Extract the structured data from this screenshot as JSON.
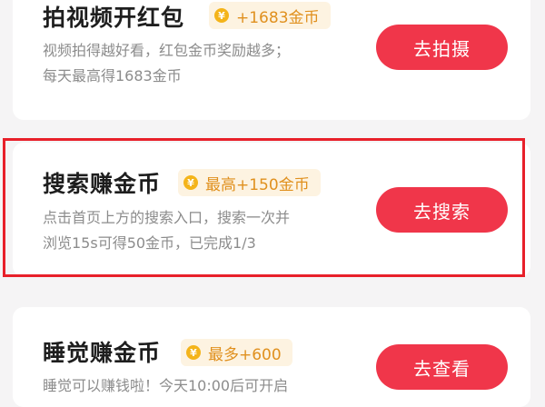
{
  "tasks": [
    {
      "title": "拍视频开红包",
      "badge": "+1683金币",
      "desc_line1": "视频拍得越好看，红包金币奖励越多；",
      "desc_line2": "每天最高得1683金币",
      "button": "去拍摄"
    },
    {
      "title": "搜索赚金币",
      "badge": "最高+150金币",
      "desc_line1": "点击首页上方的搜索入口，搜索一次并",
      "desc_line2": "浏览15s可得50金币，已完成1/3",
      "button": "去搜索"
    },
    {
      "title": "睡觉赚金币",
      "badge": "最多+600",
      "desc_line1": "睡觉可以赚钱啦！今天10:00后可开启",
      "button": "去查看"
    }
  ],
  "coin_symbol": "¥",
  "colors": {
    "accent_button": "#f0364a",
    "badge_text": "#e0901e",
    "badge_bg": "#fdf3e1",
    "coin": "#f4b41a",
    "highlight_frame": "#e8202a"
  }
}
